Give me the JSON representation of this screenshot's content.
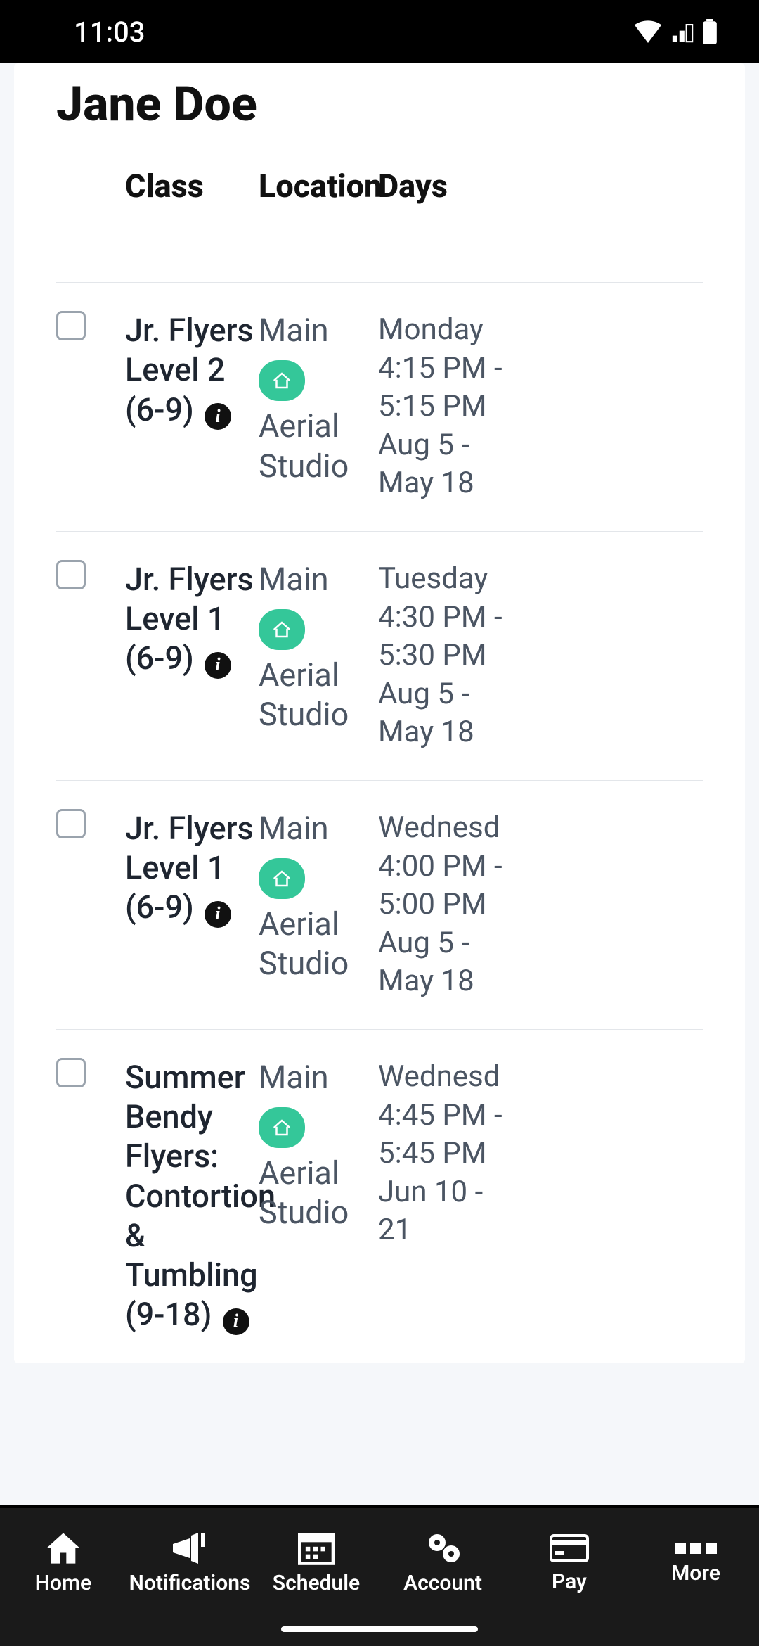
{
  "status": {
    "time": "11:03"
  },
  "student": {
    "name": "Jane Doe"
  },
  "headers": {
    "class": "Class",
    "location": "Location",
    "days": "Days"
  },
  "rows": [
    {
      "class_name": "Jr. Flyers Level 2 (6-9)",
      "loc_main": "Main",
      "loc_room": "Aerial Studio",
      "day_line1": "Monday",
      "day_line2": "4:15 PM -",
      "day_line3": "5:15 PM",
      "day_line4": "Aug 5 -",
      "day_line5": "May 18"
    },
    {
      "class_name": "Jr. Flyers Level 1 (6-9)",
      "loc_main": "Main",
      "loc_room": "Aerial Studio",
      "day_line1": "Tuesday",
      "day_line2": "4:30 PM -",
      "day_line3": "5:30 PM",
      "day_line4": "Aug 5 -",
      "day_line5": "May 18"
    },
    {
      "class_name": "Jr. Flyers Level 1 (6-9)",
      "loc_main": "Main",
      "loc_room": "Aerial Studio",
      "day_line1": "Wednesd",
      "day_line2": "4:00 PM -",
      "day_line3": "5:00 PM",
      "day_line4": "Aug 5 -",
      "day_line5": "May 18"
    },
    {
      "class_name": "Summer Bendy Flyers: Contortion & Tumbling (9-18)",
      "loc_main": "Main",
      "loc_room": "Aerial Studio",
      "day_line1": "Wednesd",
      "day_line2": "4:45 PM -",
      "day_line3": "5:45 PM",
      "day_line4": "Jun 10 -",
      "day_line5": "21"
    }
  ],
  "nav": {
    "home": "Home",
    "notifications": "Notifications",
    "schedule": "Schedule",
    "account": "Account",
    "pay": "Pay",
    "more": "More"
  }
}
